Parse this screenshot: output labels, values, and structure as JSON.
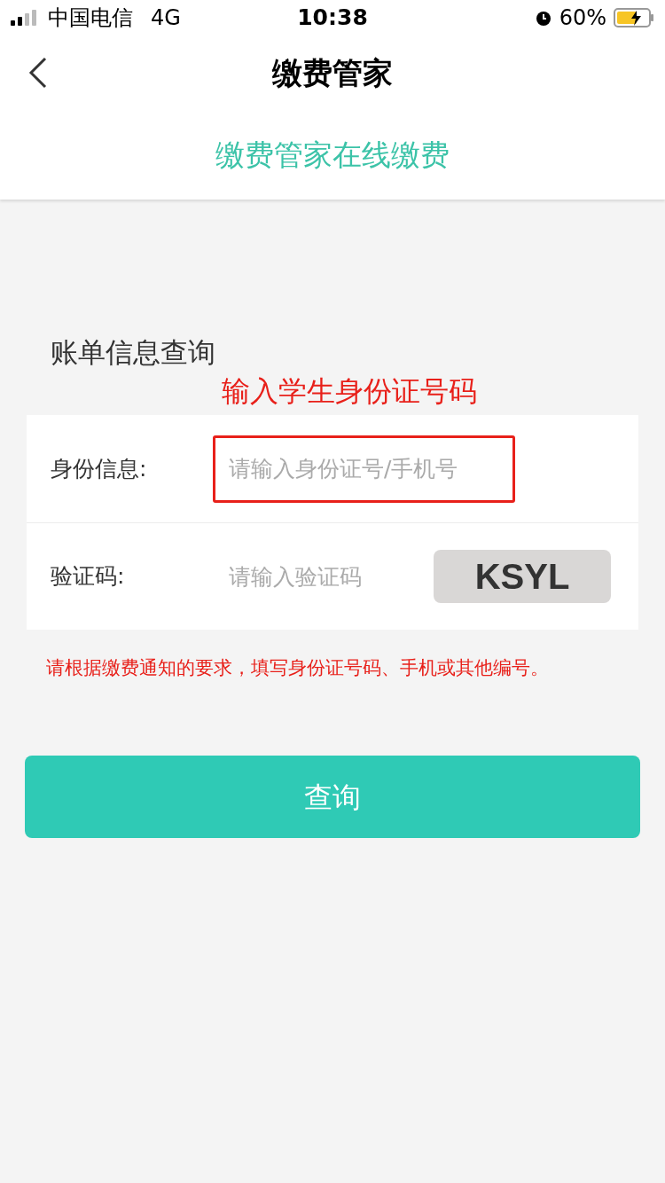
{
  "status_bar": {
    "carrier": "中国电信",
    "network": "4G",
    "time": "10:38",
    "battery": "60%"
  },
  "nav": {
    "title": "缴费管家"
  },
  "subtitle": "缴费管家在线缴费",
  "section_title": "账单信息查询",
  "annotation": "输入学生身份证号码",
  "fields": [
    {
      "label": "身份信息:",
      "placeholder": "请输入身份证号/手机号",
      "highlighted": true
    },
    {
      "label": "验证码:",
      "placeholder": "请输入验证码",
      "highlighted": false,
      "captcha": "KSYL"
    }
  ],
  "note": "请根据缴费通知的要求，填写身份证号码、手机或其他编号。",
  "button": "查询"
}
